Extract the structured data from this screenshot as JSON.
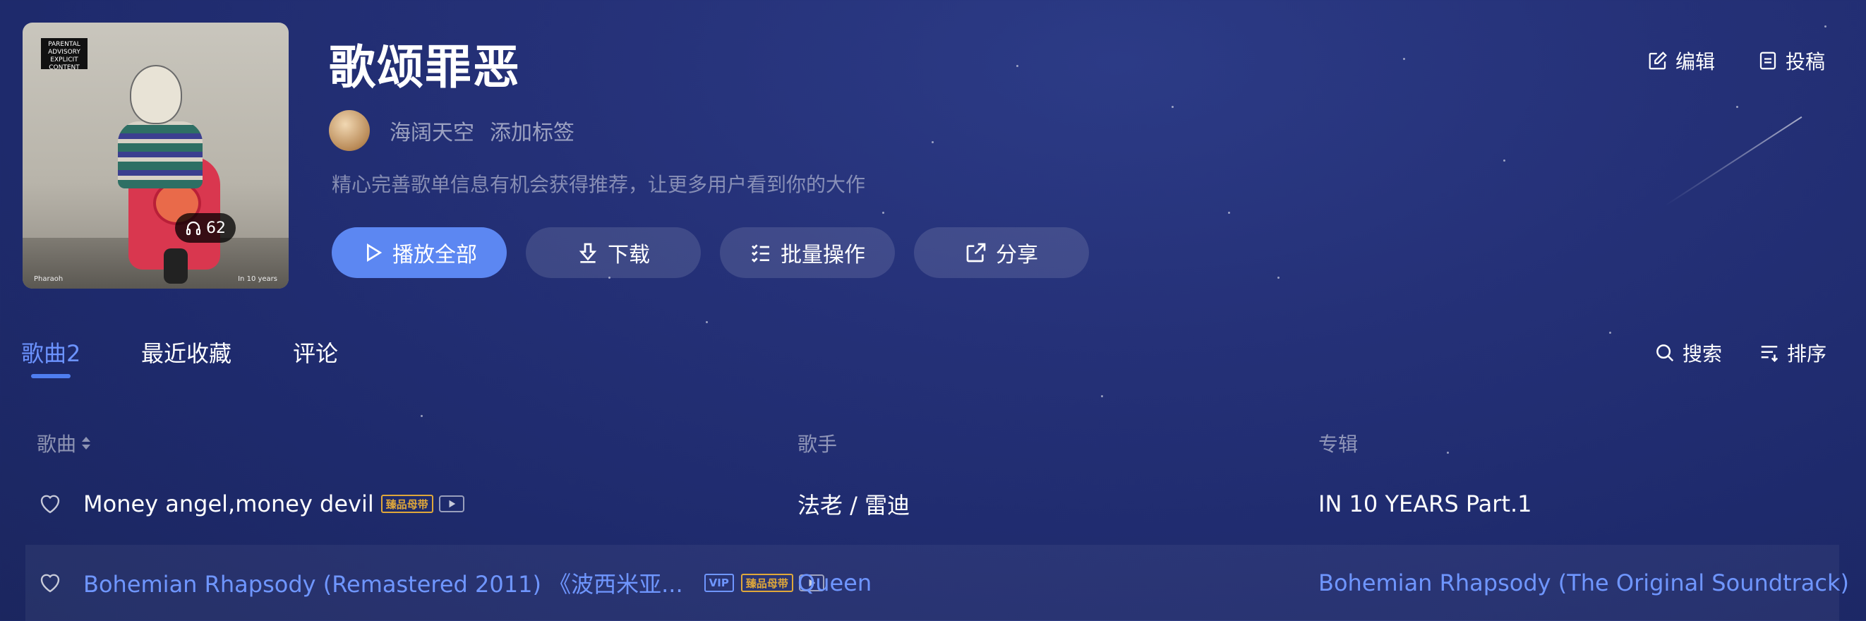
{
  "playlist": {
    "title": "歌颂罪恶",
    "play_count": "62",
    "creator_name": "海阔天空",
    "add_tag": "添加标签",
    "description": "精心完善歌单信息有机会获得推荐，让更多用户看到你的大作",
    "cover_advisory": "PARENTAL ADVISORY EXPLICIT CONTENT",
    "cover_caption_left": "Pharaoh",
    "cover_caption_right": "In 10 years"
  },
  "actions": {
    "play_all": "播放全部",
    "download": "下载",
    "batch": "批量操作",
    "share": "分享",
    "edit": "编辑",
    "contribute": "投稿"
  },
  "tabs": [
    {
      "label": "歌曲2",
      "active": true
    },
    {
      "label": "最近收藏",
      "active": false
    },
    {
      "label": "评论",
      "active": false
    }
  ],
  "tools": {
    "search": "搜索",
    "sort": "排序"
  },
  "table": {
    "headers": {
      "song": "歌曲",
      "artist": "歌手",
      "album": "专辑"
    },
    "rows": [
      {
        "title": "Money angel,money devil",
        "badges": [
          "臻品母带"
        ],
        "artist": "法老 / 雷迪",
        "album": "IN 10 YEARS Part.1",
        "playing": false
      },
      {
        "title": "Bohemian Rhapsody (Remastered 2011) 《波西米亚...",
        "badges": [
          "VIP",
          "臻品母带"
        ],
        "artist": "Queen",
        "album": "Bohemian Rhapsody (The Original Soundtrack)",
        "playing": true
      }
    ]
  },
  "colors": {
    "accent": "#5c87f2",
    "active_text": "#6f96ff",
    "badge_gold": "#e0a83a",
    "background": "#253178"
  }
}
